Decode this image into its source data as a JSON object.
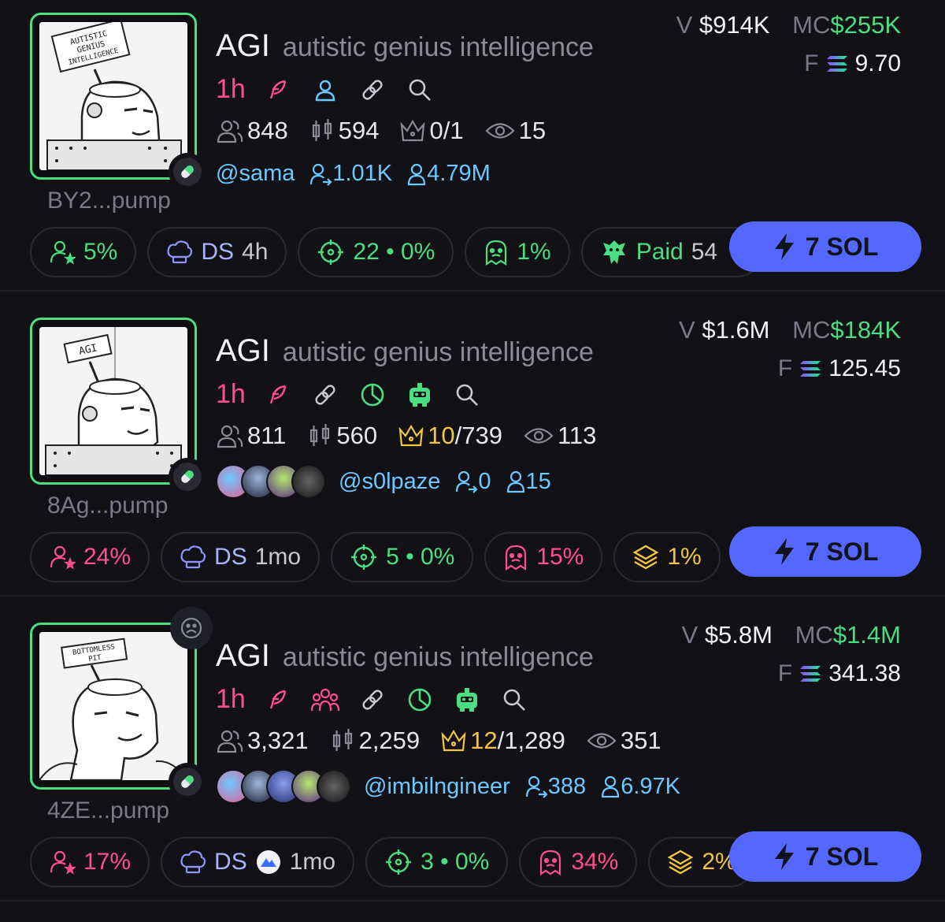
{
  "tokens": [
    {
      "ticker": "AGI",
      "name": "autistic genius intelligence",
      "address": "BY2...pump",
      "age": "1h",
      "meme_label": "AUTISTIC GENIUS INTELLIGENCE",
      "volume_label": "V",
      "volume": "$914K",
      "mc_label": "MC",
      "mc": "$255K",
      "fee_label": "F",
      "fee": "9.70",
      "holders": "848",
      "trades": "594",
      "top": "0/1",
      "top_highlight": "",
      "top_rest": "",
      "watchers": "15",
      "twitter_handle": "@sama",
      "following": "1.01K",
      "followers": "4.79M",
      "chips": {
        "holders_pct": "5%",
        "dev_label": "DS",
        "dev_value": "4h",
        "snipers": "22 • 0%",
        "insiders": "1%",
        "paid_label": "Paid",
        "paid_value": "54"
      },
      "buy_label": "7 SOL"
    },
    {
      "ticker": "AGI",
      "name": "autistic genius intelligence",
      "address": "8Ag...pump",
      "age": "1h",
      "meme_label": "AGI",
      "volume_label": "V",
      "volume": "$1.6M",
      "mc_label": "MC",
      "mc": "$184K",
      "fee_label": "F",
      "fee": "125.45",
      "holders": "811",
      "trades": "560",
      "top_highlight": "10",
      "top_rest": "/739",
      "watchers": "113",
      "twitter_handle": "@s0lpaze",
      "following": "0",
      "followers": "15",
      "chips": {
        "holders_pct": "24%",
        "dev_label": "DS",
        "dev_value": "1mo",
        "snipers": "5 • 0%",
        "insiders": "15%",
        "bundles": "1%"
      },
      "buy_label": "7 SOL"
    },
    {
      "ticker": "AGI",
      "name": "autistic genius intelligence",
      "address": "4ZE...pump",
      "age": "1h",
      "meme_label": "BOTTOMLESS PIT",
      "volume_label": "V",
      "volume": "$5.8M",
      "mc_label": "MC",
      "mc": "$1.4M",
      "fee_label": "F",
      "fee": "341.38",
      "holders": "3,321",
      "trades": "2,259",
      "top_highlight": "12",
      "top_rest": "/1,289",
      "watchers": "351",
      "twitter_handle": "@imbilngineer",
      "following": "388",
      "followers": "6.97K",
      "chips": {
        "holders_pct": "17%",
        "dev_label": "DS",
        "dev_value": "1mo",
        "snipers": "3 • 0%",
        "insiders": "34%",
        "bundles": "2%"
      },
      "buy_label": "7 SOL"
    }
  ],
  "colors": {
    "accent_green": "#4ade80",
    "age_pink": "#ff4f8b",
    "link_blue": "#6cc8ff",
    "buy_button": "#5468ff",
    "gold": "#f5c542"
  }
}
